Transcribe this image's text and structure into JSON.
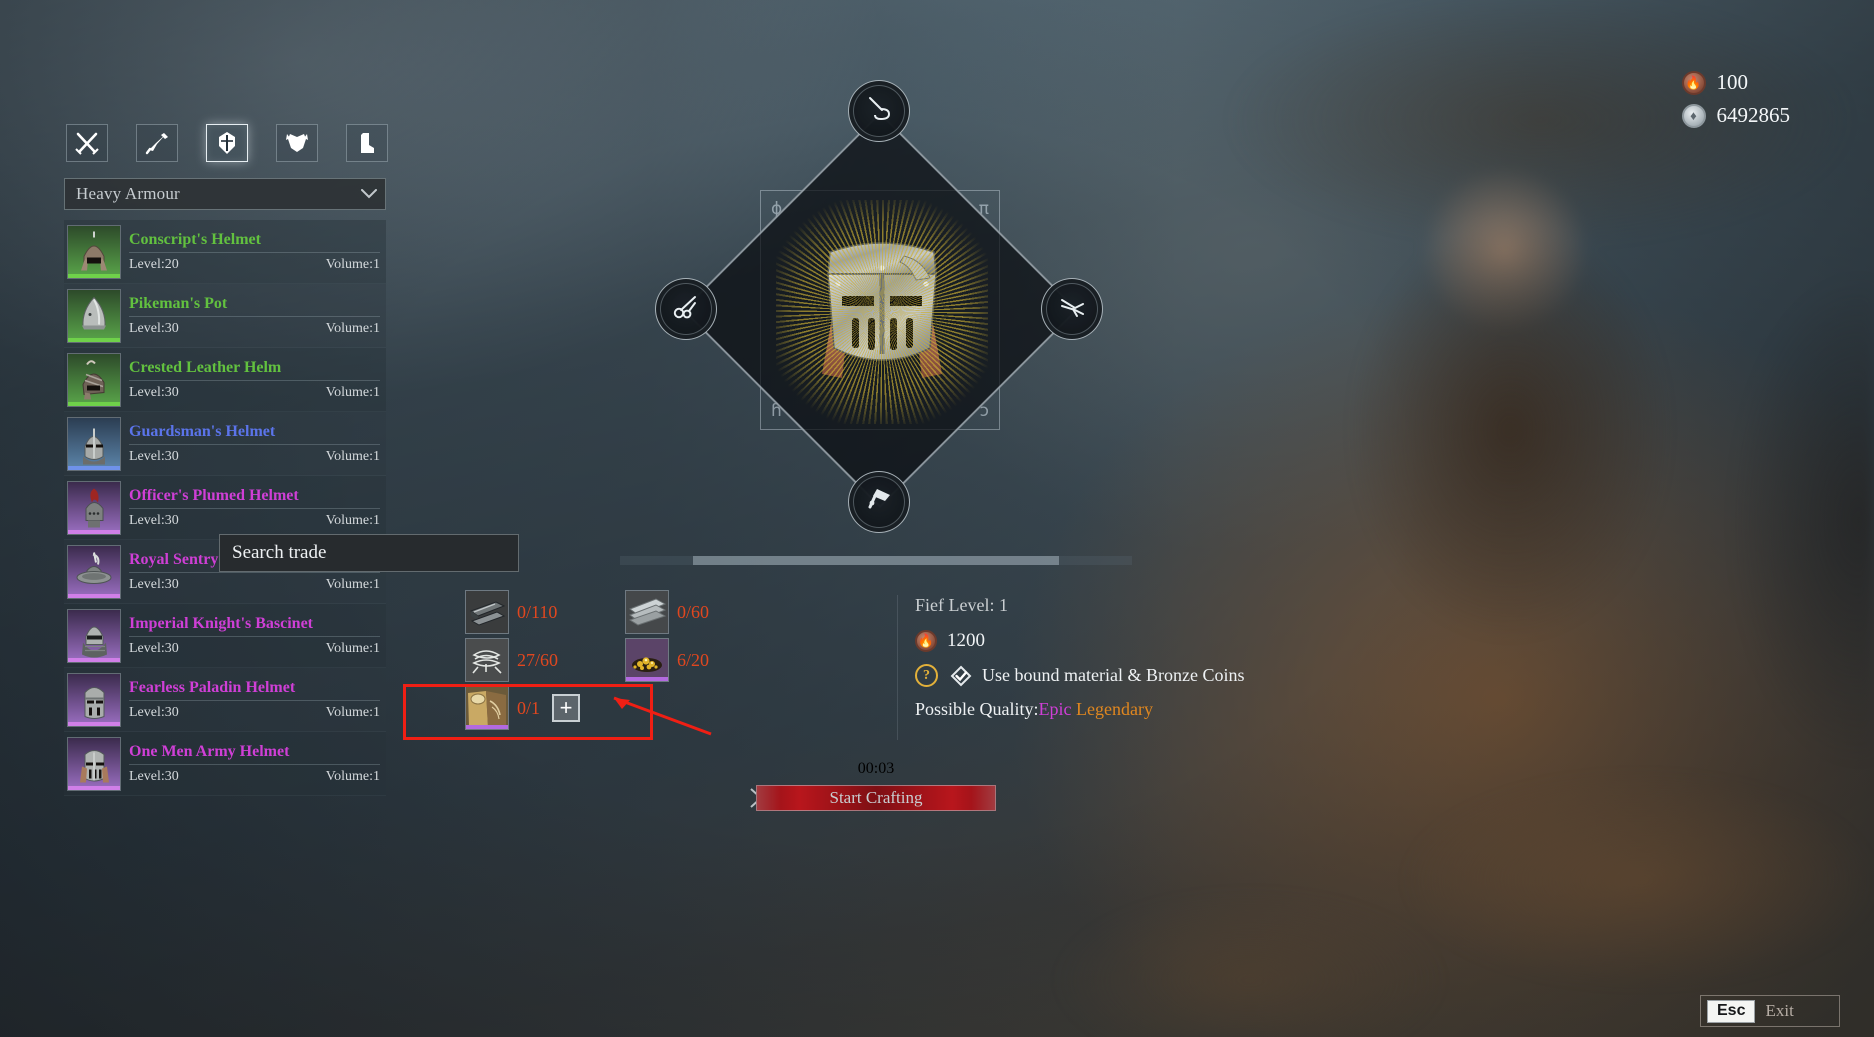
{
  "tabs": [
    {
      "name": "weapons",
      "icon": "crossed-swords-icon",
      "active": false
    },
    {
      "name": "polearms",
      "icon": "spear-icon",
      "active": false
    },
    {
      "name": "helmets",
      "icon": "helmet-icon",
      "active": true
    },
    {
      "name": "body-armour",
      "icon": "cuirass-icon",
      "active": false
    },
    {
      "name": "boots",
      "icon": "boot-icon",
      "active": false
    }
  ],
  "dropdown": {
    "label": "Heavy Armour",
    "arrow_icon": "chevron-down-icon"
  },
  "item_list": {
    "level_label_prefix": "Level:",
    "volume_label_prefix": "Volume:",
    "items": [
      {
        "name": "Conscript's Helmet",
        "level": "Level:20",
        "volume": "Volume:1",
        "quality": "common",
        "accent": "#62c13f"
      },
      {
        "name": "Pikeman's Pot",
        "level": "Level:30",
        "volume": "Volume:1",
        "quality": "common",
        "accent": "#62c13f"
      },
      {
        "name": "Crested Leather Helm",
        "level": "Level:30",
        "volume": "Volume:1",
        "quality": "common",
        "accent": "#62c13f"
      },
      {
        "name": "Guardsman's Helmet",
        "level": "Level:30",
        "volume": "Volume:1",
        "quality": "rare",
        "accent": "#5b74ea"
      },
      {
        "name": "Officer's Plumed Helmet",
        "level": "Level:30",
        "volume": "Volume:1",
        "quality": "epic",
        "accent": "#cf3fd6"
      },
      {
        "name": "Royal Sentry's Helmet",
        "level": "Level:30",
        "volume": "Volume:1",
        "quality": "epic",
        "accent": "#cf3fd6"
      },
      {
        "name": "Imperial Knight's Bascinet",
        "level": "Level:30",
        "volume": "Volume:1",
        "quality": "epic",
        "accent": "#cf3fd6"
      },
      {
        "name": "Fearless Paladin Helmet",
        "level": "Level:30",
        "volume": "Volume:1",
        "quality": "epic",
        "accent": "#cf3fd6"
      },
      {
        "name": "One Men Army Helmet",
        "level": "Level:30",
        "volume": "Volume:1",
        "quality": "epic",
        "accent": "#cf3fd6"
      }
    ]
  },
  "tooltip": {
    "search_trade": "Search trade"
  },
  "craft_stage": {
    "selected_item_icon": "great-helm-icon",
    "nodes": [
      {
        "position": "top",
        "name": "node-needle",
        "icon": "needle-thread-icon"
      },
      {
        "position": "left",
        "name": "node-scissors",
        "icon": "scissors-icon"
      },
      {
        "position": "right",
        "name": "node-tongs",
        "icon": "tongs-icon"
      },
      {
        "position": "bottom",
        "name": "node-hammer",
        "icon": "hammer-anvil-icon"
      }
    ],
    "runes": [
      "ɸ",
      "π",
      "ɦ",
      "ɔ"
    ]
  },
  "materials": {
    "cells": [
      {
        "name": "iron-ingot",
        "icon": "iron-bar-icon",
        "count": "0/110",
        "rarity": "none"
      },
      {
        "name": "steel-plate",
        "icon": "metal-sheet-icon",
        "count": "0/60",
        "rarity": "none"
      },
      {
        "name": "linen-thread",
        "icon": "thread-bundle-icon",
        "count": "27/60",
        "rarity": "none"
      },
      {
        "name": "gold-ore",
        "icon": "gold-nugget-icon",
        "count": "6/20",
        "rarity": "epic"
      },
      {
        "name": "blueprint-scroll",
        "icon": "scroll-parchment-icon",
        "count": "0/1",
        "rarity": "epic",
        "has_add_button": true,
        "add_label": "+"
      }
    ],
    "count_color": "#e0471f",
    "highlight_color": "#f01f14"
  },
  "info_panel": {
    "fief_level": "Fief Level: 1",
    "cost": "1200",
    "cost_coin": "bronze-coin-icon",
    "help_icon": "question-mark-icon",
    "bound_checkbox_icon": "diamond-check-icon",
    "bound_label": "Use bound material & Bronze Coins",
    "quality_label": "Possible Quality:",
    "quality_values": [
      {
        "text": "Epic",
        "color": "#cf3fd6"
      },
      {
        "text": "Legendary",
        "color": "#e0871f"
      }
    ]
  },
  "currency_hud": [
    {
      "name": "bronze-coin",
      "icon": "bronze-coin-icon",
      "value": "100"
    },
    {
      "name": "silver-coin",
      "icon": "silver-coin-icon",
      "value": "6492865"
    }
  ],
  "craft_footer": {
    "timer": "00:03",
    "button_label": "Start Crafting",
    "button_color": "#b8161c"
  },
  "esc_exit": {
    "key": "Esc",
    "label": "Exit"
  },
  "scrollbar": {
    "name": "horizontal-scrollbar"
  }
}
